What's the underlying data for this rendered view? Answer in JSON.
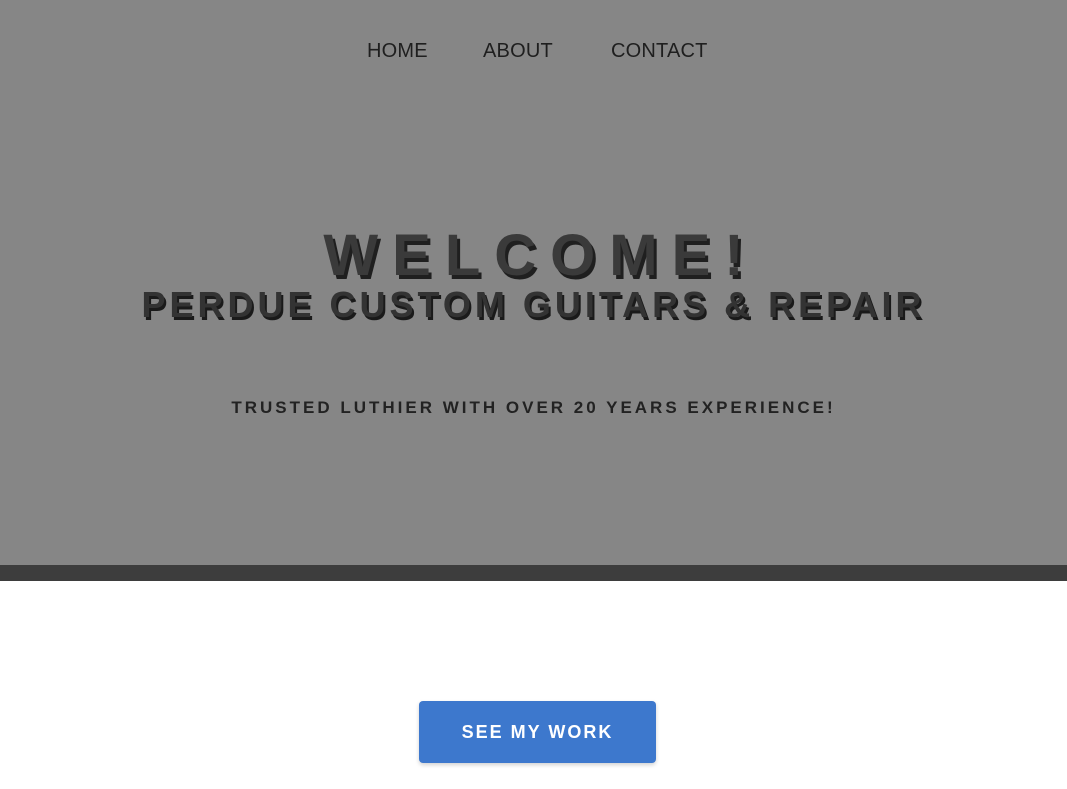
{
  "nav": {
    "items": [
      {
        "label": "HOME"
      },
      {
        "label": "ABOUT"
      },
      {
        "label": "CONTACT"
      }
    ]
  },
  "hero": {
    "welcome": "WELCOME!",
    "business_name": "PERDUE CUSTOM GUITARS & REPAIR",
    "tagline": "TRUSTED LUTHIER WITH OVER 20 YEARS EXPERIENCE!"
  },
  "cta": {
    "label": "SEE MY WORK"
  },
  "colors": {
    "hero_background": "#868686",
    "hero_bottom_bar": "#3d3d3d",
    "cta_background": "#3d78cd"
  }
}
